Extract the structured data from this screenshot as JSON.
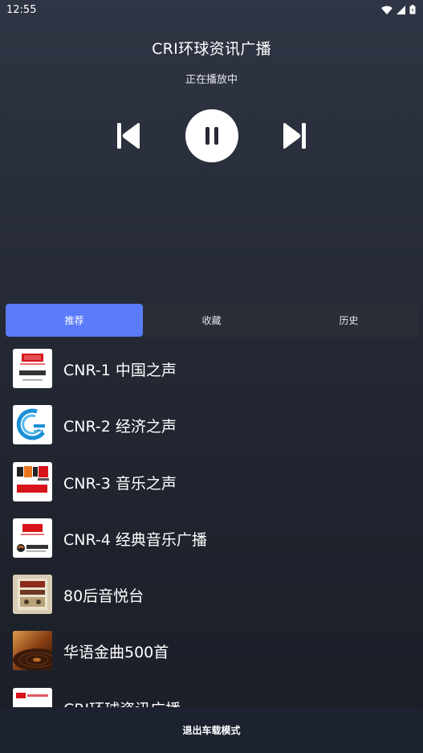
{
  "status": {
    "time": "12:55"
  },
  "player": {
    "title": "CRI环球资讯广播",
    "state": "正在播放中"
  },
  "tabs": [
    {
      "label": "推荐"
    },
    {
      "label": "收藏"
    },
    {
      "label": "历史"
    }
  ],
  "stations": [
    {
      "name": "CNR-1 中国之声",
      "icon": "cnr1-logo"
    },
    {
      "name": "CNR-2 经济之声",
      "icon": "cnr2-logo"
    },
    {
      "name": "CNR-3 音乐之声",
      "icon": "cnr3-logo"
    },
    {
      "name": "CNR-4 经典音乐广播",
      "icon": "cnr4-logo"
    },
    {
      "name": "80后音悦台",
      "icon": "80s-logo"
    },
    {
      "name": "华语金曲500首",
      "icon": "vinyl-logo"
    },
    {
      "name": "CRI环球资讯广播",
      "icon": "cri-logo"
    }
  ],
  "bottom": {
    "exit_label": "退出车载模式"
  },
  "colors": {
    "accent": "#5b7cfa",
    "tab_bg": "#2b2e36",
    "bottom_bg": "#1d2230"
  }
}
